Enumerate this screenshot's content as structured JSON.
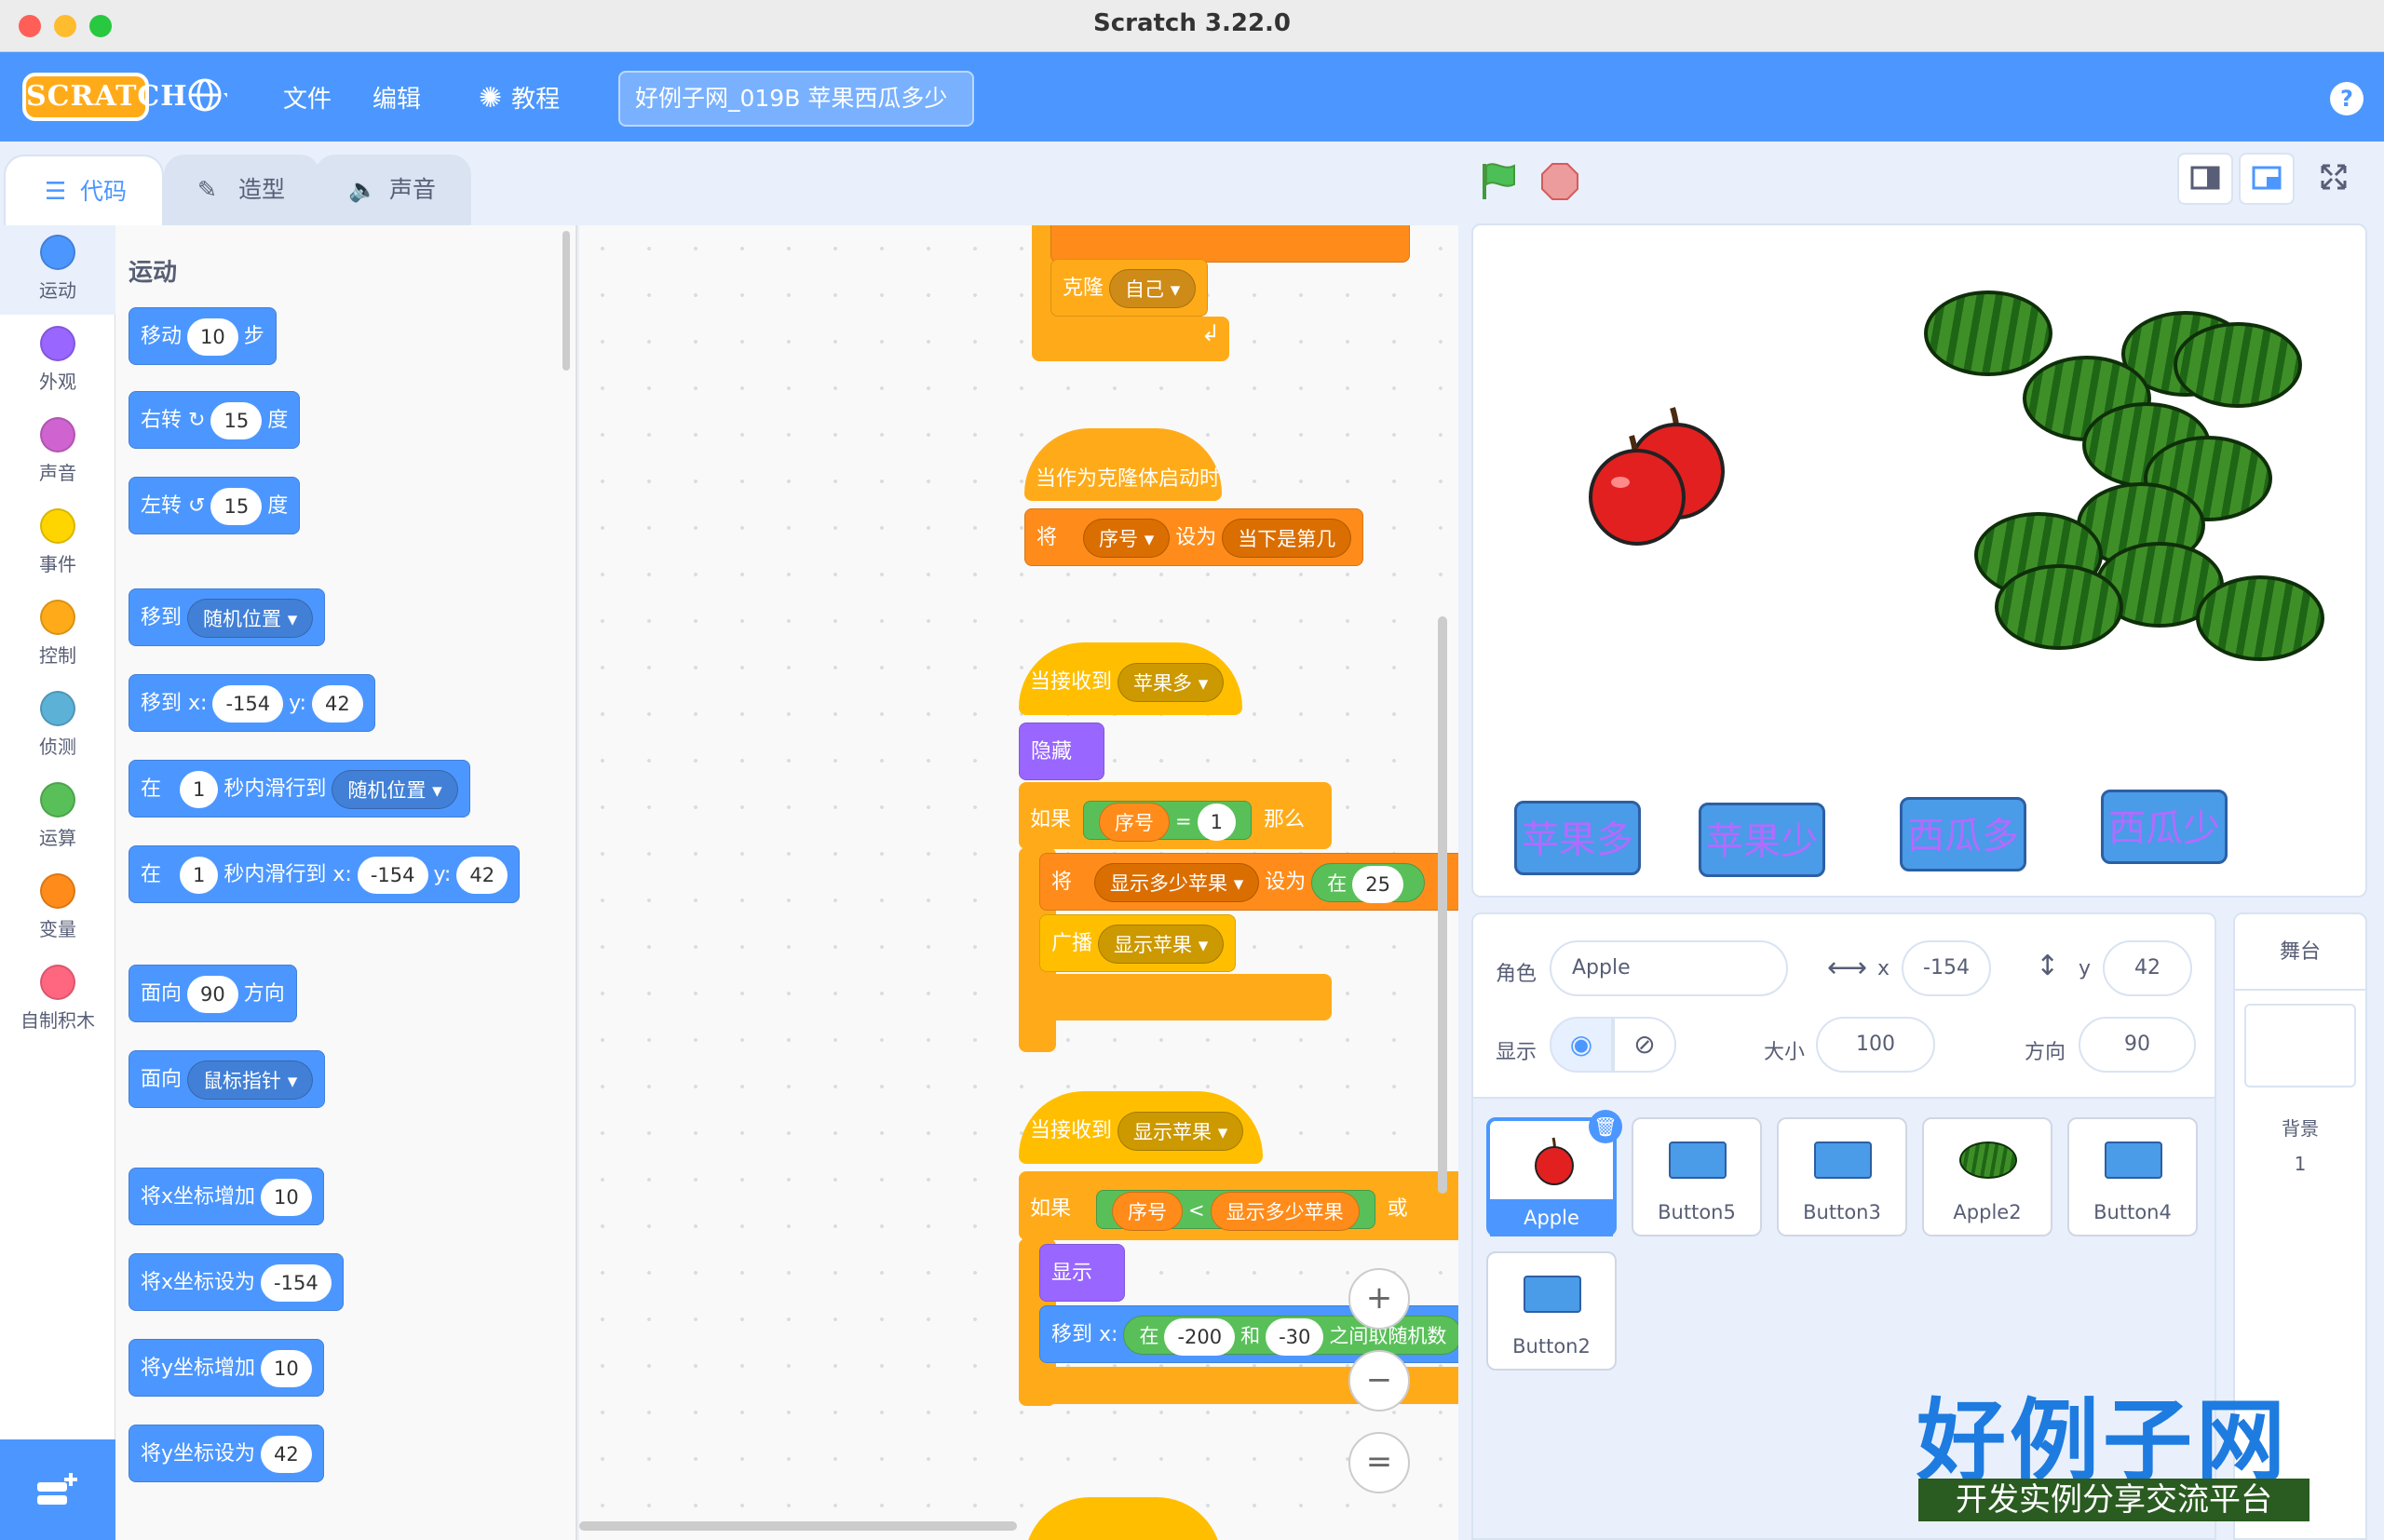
{
  "window": {
    "title": "Scratch 3.22.0"
  },
  "menu": {
    "logo": "SCRATCH",
    "file": "文件",
    "edit": "编辑",
    "tutorials": "教程",
    "project_title": "好例子网_019B 苹果西瓜多少",
    "help": "?"
  },
  "tabs": {
    "code": "代码",
    "costumes": "造型",
    "sounds": "声音"
  },
  "categories": [
    {
      "label": "运动",
      "color": "#4c97ff"
    },
    {
      "label": "外观",
      "color": "#9966ff"
    },
    {
      "label": "声音",
      "color": "#cf63cf"
    },
    {
      "label": "事件",
      "color": "#ffd500"
    },
    {
      "label": "控制",
      "color": "#ffab19"
    },
    {
      "label": "侦测",
      "color": "#5cb1d6"
    },
    {
      "label": "运算",
      "color": "#59c059"
    },
    {
      "label": "变量",
      "color": "#ff8c1a"
    },
    {
      "label": "自制积木",
      "color": "#ff6680"
    }
  ],
  "palette": {
    "title": "运动",
    "move": {
      "a": "移动",
      "v": "10",
      "b": "步"
    },
    "turn_right": {
      "a": "右转",
      "v": "15",
      "b": "度"
    },
    "turn_left": {
      "a": "左转",
      "v": "15",
      "b": "度"
    },
    "goto": {
      "a": "移到",
      "d": "随机位置"
    },
    "goto_xy": {
      "a": "移到 x:",
      "x": "-154",
      "b": "y:",
      "y": "42"
    },
    "glide": {
      "a": "在",
      "v": "1",
      "b": "秒内滑行到",
      "d": "随机位置"
    },
    "glide_xy": {
      "a": "在",
      "v": "1",
      "b": "秒内滑行到 x:",
      "x": "-154",
      "c": "y:",
      "y": "42"
    },
    "point_dir": {
      "a": "面向",
      "v": "90",
      "b": "方向"
    },
    "point_towards": {
      "a": "面向",
      "d": "鼠标指针"
    },
    "change_x": {
      "a": "将x坐标增加",
      "v": "10"
    },
    "set_x": {
      "a": "将x坐标设为",
      "v": "-154"
    },
    "change_y": {
      "a": "将y坐标增加",
      "v": "10"
    },
    "set_y": {
      "a": "将y坐标设为",
      "v": "42"
    }
  },
  "scripts": {
    "top_clone": {
      "a": "克隆",
      "d": "自己"
    },
    "hat1": "当作为克隆体启动时",
    "set1": {
      "a": "将",
      "d": "序号",
      "b": "设为",
      "v": "当下是第几"
    },
    "hat2": {
      "a": "当接收到",
      "d": "苹果多"
    },
    "hide": "隐藏",
    "if1": {
      "a": "如果",
      "var": "序号",
      "op": "=",
      "v": "1",
      "b": "那么"
    },
    "set2": {
      "a": "将",
      "d": "显示多少苹果",
      "b": "设为",
      "c": "在",
      "v": "25"
    },
    "broadcast": {
      "a": "广播",
      "d": "显示苹果"
    },
    "hat3": {
      "a": "当接收到",
      "d": "显示苹果"
    },
    "if2": {
      "a": "如果",
      "var": "序号",
      "op": "<",
      "v": "显示多少苹果",
      "b": "或"
    },
    "show": "显示",
    "goto2": {
      "a": "移到 x:",
      "b": "在",
      "v1": "-200",
      "c": "和",
      "v2": "-30",
      "d": "之间取随机数"
    }
  },
  "zoom": {
    "in": "+",
    "out": "−",
    "reset": "="
  },
  "stage": {
    "buttons": [
      {
        "label": "苹果多",
        "bg": "#4a9be8"
      },
      {
        "label": "苹果少",
        "bg": "#4a9be8"
      },
      {
        "label": "西瓜多",
        "bg": "#4a9be8"
      },
      {
        "label": "西瓜少",
        "bg": "#4a9be8"
      }
    ]
  },
  "sprite_info": {
    "sprite_label": "角色",
    "sprite_name": "Apple",
    "x_label": "x",
    "x": "-154",
    "y_label": "y",
    "y": "42",
    "show_label": "显示",
    "size_label": "大小",
    "size": "100",
    "direction_label": "方向",
    "direction": "90"
  },
  "sprites": [
    {
      "name": "Apple",
      "selected": true
    },
    {
      "name": "Button5"
    },
    {
      "name": "Button3"
    },
    {
      "name": "Apple2"
    },
    {
      "name": "Button4"
    },
    {
      "name": "Button2"
    }
  ],
  "stage_pane": {
    "title": "舞台",
    "backdrop_label": "背景",
    "backdrop_count": "1"
  },
  "watermark": {
    "big": "好例子网",
    "small": "开发实例分享交流平台"
  }
}
